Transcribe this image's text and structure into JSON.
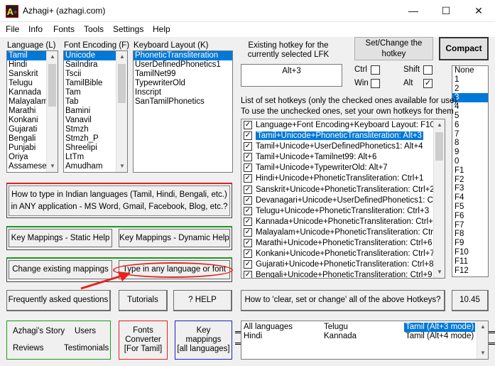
{
  "window": {
    "title": "Azhagi+ (azhagi.com)",
    "icon_text": "A",
    "controls": [
      "—",
      "☐",
      "✕"
    ]
  },
  "menu": [
    "File",
    "Info",
    "Fonts",
    "Tools",
    "Settings",
    "Help"
  ],
  "language": {
    "label": "Language (L)",
    "items": [
      "Tamil",
      "Hindi",
      "Sanskrit",
      "Telugu",
      "Kannada",
      "Malayalam",
      "Marathi",
      "Konkani",
      "Gujarati",
      "Bengali",
      "Punjabi",
      "Oriya",
      "Assamese"
    ],
    "selected": 0
  },
  "font_encoding": {
    "label": "Font Encoding (F)",
    "items": [
      "Unicode",
      "SaiIndira",
      "Tscii",
      "TamilBible",
      "Tam",
      "Tab",
      "Bamini",
      "Vanavil",
      "Stmzh",
      "Stmzh_P",
      "Shreelipi",
      "LtTm",
      "Amudham"
    ],
    "selected": 0
  },
  "keyboard_layout": {
    "label": "Keyboard Layout (K)",
    "items": [
      "PhoneticTransliteration",
      "UserDefinedPhonetics1",
      "TamilNet99",
      "TypewriterOld",
      "Inscript",
      "SanTamilPhonetics"
    ],
    "selected": 0
  },
  "hotkey": {
    "existing_label": "Existing hotkey for the currently selected LFK",
    "existing_value": "Alt+3",
    "set_change_button": "Set/Change the hotkey",
    "compact_button": "Compact",
    "ctrl_label": "Ctrl",
    "shift_label": "Shift",
    "win_label": "Win",
    "alt_label": "Alt",
    "ctrl_checked": false,
    "shift_checked": false,
    "win_checked": false,
    "alt_checked": true
  },
  "hotkeys_list": {
    "header_line1": "List of set hotkeys (only the checked ones available for use)",
    "header_line2": "To use the unchecked ones, set your own hotkeys for them",
    "items": [
      "Language+Font Encoding+Keyboard Layout: F10",
      "Tamil+Unicode+PhoneticTransliteration: Alt+3",
      "Tamil+Unicode+UserDefinedPhonetics1: Alt+4",
      "Tamil+Unicode+Tamilnet99: Alt+6",
      "Tamil+Unicode+TypewriterOld: Alt+7",
      "Hindi+Unicode+PhoneticTransliteration: Ctrl+1",
      "Sanskrit+Unicode+PhoneticTransliteration: Ctrl+2",
      "Devanagari+Unicode+UserDefinedPhonetics1: Ctrl+F",
      "Telugu+Unicode+PhoneticTransliteration: Ctrl+3",
      "Kannada+Unicode+PhoneticTransliteration: Ctrl+4",
      "Malayalam+Unicode+PhoneticTransliteration: Ctrl+5",
      "Marathi+Unicode+PhoneticTransliteration: Ctrl+6",
      "Konkani+Unicode+PhoneticTransliteration: Ctrl+7",
      "Gujarati+Unicode+PhoneticTransliteration: Ctrl+8",
      "Bengali+Unicode+PhoneticTransliteration: Ctrl+9"
    ],
    "selected": 1
  },
  "key_options": {
    "items": [
      "None",
      "1",
      "2",
      "3",
      "4",
      "5",
      "6",
      "7",
      "8",
      "9",
      "0",
      "F1",
      "F2",
      "F3",
      "F4",
      "F5",
      "F6",
      "F7",
      "F8",
      "F9",
      "F10",
      "F11",
      "F12"
    ],
    "selected": 3
  },
  "buttons": {
    "how_to_type_line1": "How to type in Indian languages (Tamil, Hindi, Bengali, etc.)",
    "how_to_type_line2": "in ANY application - MS Word, Gmail, Facebook, Blog, etc.?",
    "key_mappings_static": "Key Mappings - Static Help",
    "key_mappings_dynamic": "Key Mappings - Dynamic Help",
    "change_mappings": "Change existing mappings",
    "type_any_language": "Type in any language or font",
    "faq": "Frequently asked questions",
    "tutorials": "Tutorials",
    "help": "?  HELP",
    "how_to_clear": "How to 'clear, set or change' all of the above Hotkeys?",
    "version": "10.45",
    "azhagis_story": "Azhagi's Story",
    "users": "Users",
    "reviews": "Reviews",
    "testimonials": "Testimonials",
    "fonts_converter_line1": "Fonts",
    "fonts_converter_line2": "Converter",
    "fonts_converter_line3": "[For Tamil]",
    "key_mappings_all_line1": "Key",
    "key_mappings_all_line2": "mappings",
    "key_mappings_all_line3": "[all languages]"
  },
  "bottom_list": {
    "col1": [
      "All languages",
      "Hindi"
    ],
    "col2": [
      "Telugu",
      "Kannada"
    ],
    "col3": [
      "Tamil (Alt+3 mode)",
      "Tamil (Alt+4 mode)"
    ],
    "selected_col3": 0
  },
  "colors": {
    "selection": "#0078d7",
    "green_border": "#1a9c1a",
    "red_border": "#e02020",
    "blue_border": "#2020c0",
    "annotation_red": "#e8231f"
  }
}
